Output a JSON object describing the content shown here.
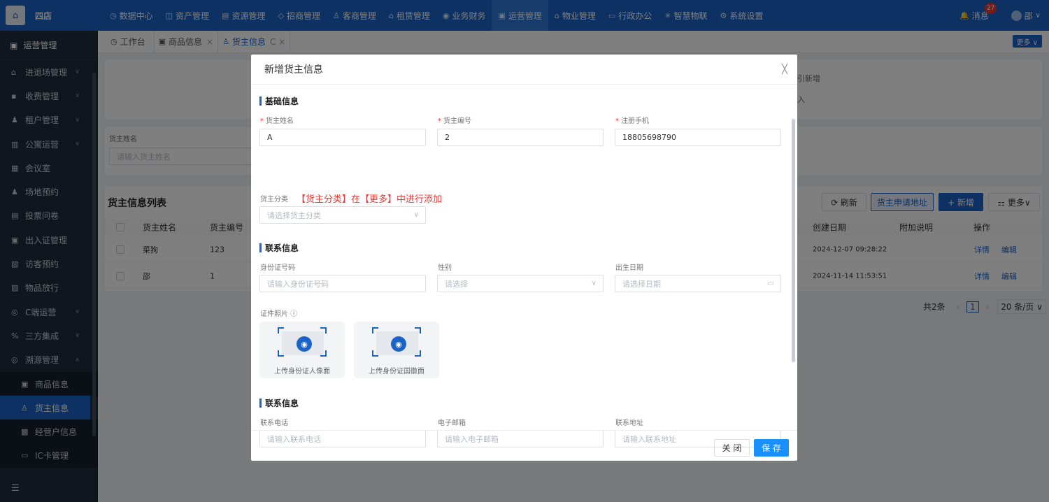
{
  "topbar": {
    "logo_glyph": "⌂",
    "brand": "四店",
    "nav": [
      {
        "label": "数据中心",
        "icon": "clock-icon",
        "glyph": "◷"
      },
      {
        "label": "资产管理",
        "icon": "box-icon",
        "glyph": "◫"
      },
      {
        "label": "资源管理",
        "icon": "building-icon",
        "glyph": "▤"
      },
      {
        "label": "招商管理",
        "icon": "tag-icon",
        "glyph": "◇"
      },
      {
        "label": "客商管理",
        "icon": "users-icon",
        "glyph": "♙"
      },
      {
        "label": "租赁管理",
        "icon": "house-icon",
        "glyph": "⌂"
      },
      {
        "label": "业务财务",
        "icon": "coin-icon",
        "glyph": "◉"
      },
      {
        "label": "运营管理",
        "icon": "ops-icon",
        "glyph": "▣",
        "active": true
      },
      {
        "label": "物业管理",
        "icon": "home-icon",
        "glyph": "⌂"
      },
      {
        "label": "行政办公",
        "icon": "monitor-icon",
        "glyph": "▭"
      },
      {
        "label": "智慧物联",
        "icon": "iot-icon",
        "glyph": "✳"
      },
      {
        "label": "系统设置",
        "icon": "gear-icon",
        "glyph": "⚙"
      }
    ],
    "messages_label": "消息",
    "messages_glyph": "🔔",
    "messages_count": "27",
    "user_name": "邵",
    "user_caret": "∨"
  },
  "sidebar": {
    "title": "运营管理",
    "title_glyph": "▣",
    "items": [
      {
        "label": "进退场管理",
        "glyph": "⌂",
        "arrow": "∨"
      },
      {
        "label": "收费管理",
        "glyph": "▪",
        "arrow": "∨"
      },
      {
        "label": "租户管理",
        "glyph": "♟",
        "arrow": "∨"
      },
      {
        "label": "公寓运营",
        "glyph": "▥",
        "arrow": "∨"
      },
      {
        "label": "会议室",
        "glyph": "▦",
        "arrow": ""
      },
      {
        "label": "场地预约",
        "glyph": "♟",
        "arrow": ""
      },
      {
        "label": "投票问卷",
        "glyph": "▤",
        "arrow": ""
      },
      {
        "label": "出入证管理",
        "glyph": "▣",
        "arrow": ""
      },
      {
        "label": "访客预约",
        "glyph": "▧",
        "arrow": ""
      },
      {
        "label": "物品放行",
        "glyph": "▨",
        "arrow": ""
      },
      {
        "label": "C端运营",
        "glyph": "◎",
        "arrow": "∨"
      },
      {
        "label": "三方集成",
        "glyph": "%",
        "arrow": "∨"
      },
      {
        "label": "溯源管理",
        "glyph": "◎",
        "arrow": "∧"
      }
    ],
    "sub_items": [
      {
        "label": "商品信息",
        "glyph": "▣"
      },
      {
        "label": "货主信息",
        "glyph": "♙",
        "active": true
      },
      {
        "label": "经营户信息",
        "glyph": "▩"
      },
      {
        "label": "IC卡管理",
        "glyph": "▭"
      }
    ],
    "footer_glyph": "☰"
  },
  "tabs": {
    "items": [
      {
        "label": "工作台",
        "glyph": "◷",
        "close": ""
      },
      {
        "label": "商品信息",
        "glyph": "▣",
        "close": "×"
      },
      {
        "label": "货主信息",
        "glyph": "♙",
        "close": "C ×",
        "active": true
      }
    ],
    "more": "更多 ∨"
  },
  "background": {
    "hint1": "引新增",
    "hint2": "入",
    "filter_label": "货主姓名",
    "filter_placeholder": "请输入货主姓名",
    "list_title": "货主信息列表",
    "btn_refresh": "⟳ 刷新",
    "btn_address": "货主申请地址",
    "btn_add": "+ 新增",
    "btn_more": "⚏ 更多∨",
    "columns": {
      "name": "货主姓名",
      "code": "货主编号",
      "created": "创建日期",
      "note": "附加说明",
      "ops": "操作"
    },
    "rows": [
      {
        "name": "菜狗",
        "code": "123",
        "created": "2024-12-07 09:28:22",
        "detail": "详情",
        "edit": "编辑"
      },
      {
        "name": "邵",
        "code": "1",
        "created": "2024-11-14 11:53:51",
        "detail": "详情",
        "edit": "编辑"
      }
    ],
    "pager": {
      "total": "共2条",
      "prev": "‹",
      "page": "1",
      "next": "›",
      "size": "20 条/页 ∨"
    }
  },
  "modal": {
    "title": "新增货主信息",
    "close_glyph": "╳",
    "section_basic": "基础信息",
    "owner_name_label": "货主姓名",
    "owner_name_value": "A",
    "owner_code_label": "货主编号",
    "owner_code_value": "2",
    "phone_label": "注册手机",
    "phone_value": "18805698790",
    "category_label": "货主分类",
    "category_note": "【货主分类】在【更多】中进行添加",
    "category_placeholder": "请选择货主分类",
    "section_contact1": "联系信息",
    "id_label": "身份证号码",
    "id_placeholder": "请输入身份证号码",
    "gender_label": "性别",
    "gender_placeholder": "请选择",
    "birth_label": "出生日期",
    "birth_placeholder": "请选择日期",
    "photo_label": "证件照片 ⓘ",
    "upload_front": "上传身份证人像面",
    "upload_back": "上传身份证国徽面",
    "camera_glyph": "◉",
    "section_contact2": "联系信息",
    "tel_label": "联系电话",
    "tel_placeholder": "请输入联系电话",
    "email_label": "电子邮箱",
    "email_placeholder": "请输入电子邮箱",
    "addr_label": "联系地址",
    "addr_placeholder": "请输入联系地址",
    "btn_close": "关 闭",
    "btn_save": "保 存"
  }
}
